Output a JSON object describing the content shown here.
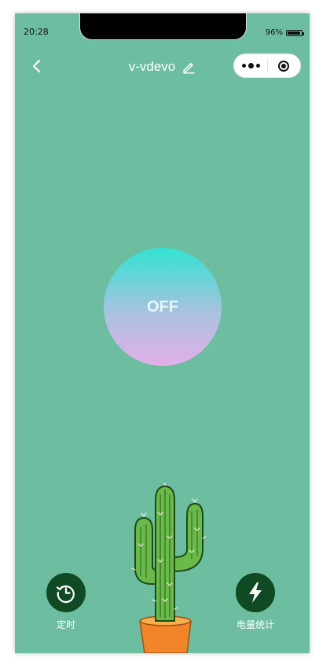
{
  "status_bar": {
    "time": "20:28",
    "battery_percent": "96%",
    "battery_level": 0.96
  },
  "nav": {
    "title": "v-vdevo",
    "back_icon": "chevron-left-icon",
    "edit_icon": "pencil-icon",
    "more_icon": "more-dots-icon",
    "close_icon": "target-circle-icon"
  },
  "device": {
    "power_state": "OFF"
  },
  "actions": {
    "timer_label": "定时",
    "timer_icon": "history-clock-icon",
    "power_stats_label": "电量统计",
    "power_stats_icon": "lightning-bolt-icon"
  },
  "colors": {
    "background": "#6dbda1",
    "action_circle": "#0f4a23",
    "gradient_top": "#31e3d4",
    "gradient_bottom": "#e4aeea"
  }
}
